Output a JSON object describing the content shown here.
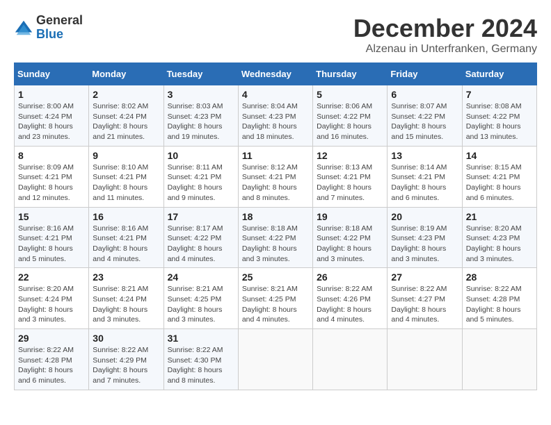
{
  "header": {
    "logo_general": "General",
    "logo_blue": "Blue",
    "month_title": "December 2024",
    "subtitle": "Alzenau in Unterfranken, Germany"
  },
  "days_of_week": [
    "Sunday",
    "Monday",
    "Tuesday",
    "Wednesday",
    "Thursday",
    "Friday",
    "Saturday"
  ],
  "weeks": [
    [
      {
        "day": "1",
        "sunrise": "8:00 AM",
        "sunset": "4:24 PM",
        "daylight": "8 hours and 23 minutes."
      },
      {
        "day": "2",
        "sunrise": "8:02 AM",
        "sunset": "4:24 PM",
        "daylight": "8 hours and 21 minutes."
      },
      {
        "day": "3",
        "sunrise": "8:03 AM",
        "sunset": "4:23 PM",
        "daylight": "8 hours and 19 minutes."
      },
      {
        "day": "4",
        "sunrise": "8:04 AM",
        "sunset": "4:23 PM",
        "daylight": "8 hours and 18 minutes."
      },
      {
        "day": "5",
        "sunrise": "8:06 AM",
        "sunset": "4:22 PM",
        "daylight": "8 hours and 16 minutes."
      },
      {
        "day": "6",
        "sunrise": "8:07 AM",
        "sunset": "4:22 PM",
        "daylight": "8 hours and 15 minutes."
      },
      {
        "day": "7",
        "sunrise": "8:08 AM",
        "sunset": "4:22 PM",
        "daylight": "8 hours and 13 minutes."
      }
    ],
    [
      {
        "day": "8",
        "sunrise": "8:09 AM",
        "sunset": "4:21 PM",
        "daylight": "8 hours and 12 minutes."
      },
      {
        "day": "9",
        "sunrise": "8:10 AM",
        "sunset": "4:21 PM",
        "daylight": "8 hours and 11 minutes."
      },
      {
        "day": "10",
        "sunrise": "8:11 AM",
        "sunset": "4:21 PM",
        "daylight": "8 hours and 9 minutes."
      },
      {
        "day": "11",
        "sunrise": "8:12 AM",
        "sunset": "4:21 PM",
        "daylight": "8 hours and 8 minutes."
      },
      {
        "day": "12",
        "sunrise": "8:13 AM",
        "sunset": "4:21 PM",
        "daylight": "8 hours and 7 minutes."
      },
      {
        "day": "13",
        "sunrise": "8:14 AM",
        "sunset": "4:21 PM",
        "daylight": "8 hours and 6 minutes."
      },
      {
        "day": "14",
        "sunrise": "8:15 AM",
        "sunset": "4:21 PM",
        "daylight": "8 hours and 6 minutes."
      }
    ],
    [
      {
        "day": "15",
        "sunrise": "8:16 AM",
        "sunset": "4:21 PM",
        "daylight": "8 hours and 5 minutes."
      },
      {
        "day": "16",
        "sunrise": "8:16 AM",
        "sunset": "4:21 PM",
        "daylight": "8 hours and 4 minutes."
      },
      {
        "day": "17",
        "sunrise": "8:17 AM",
        "sunset": "4:22 PM",
        "daylight": "8 hours and 4 minutes."
      },
      {
        "day": "18",
        "sunrise": "8:18 AM",
        "sunset": "4:22 PM",
        "daylight": "8 hours and 3 minutes."
      },
      {
        "day": "19",
        "sunrise": "8:18 AM",
        "sunset": "4:22 PM",
        "daylight": "8 hours and 3 minutes."
      },
      {
        "day": "20",
        "sunrise": "8:19 AM",
        "sunset": "4:23 PM",
        "daylight": "8 hours and 3 minutes."
      },
      {
        "day": "21",
        "sunrise": "8:20 AM",
        "sunset": "4:23 PM",
        "daylight": "8 hours and 3 minutes."
      }
    ],
    [
      {
        "day": "22",
        "sunrise": "8:20 AM",
        "sunset": "4:24 PM",
        "daylight": "8 hours and 3 minutes."
      },
      {
        "day": "23",
        "sunrise": "8:21 AM",
        "sunset": "4:24 PM",
        "daylight": "8 hours and 3 minutes."
      },
      {
        "day": "24",
        "sunrise": "8:21 AM",
        "sunset": "4:25 PM",
        "daylight": "8 hours and 3 minutes."
      },
      {
        "day": "25",
        "sunrise": "8:21 AM",
        "sunset": "4:25 PM",
        "daylight": "8 hours and 4 minutes."
      },
      {
        "day": "26",
        "sunrise": "8:22 AM",
        "sunset": "4:26 PM",
        "daylight": "8 hours and 4 minutes."
      },
      {
        "day": "27",
        "sunrise": "8:22 AM",
        "sunset": "4:27 PM",
        "daylight": "8 hours and 4 minutes."
      },
      {
        "day": "28",
        "sunrise": "8:22 AM",
        "sunset": "4:28 PM",
        "daylight": "8 hours and 5 minutes."
      }
    ],
    [
      {
        "day": "29",
        "sunrise": "8:22 AM",
        "sunset": "4:28 PM",
        "daylight": "8 hours and 6 minutes."
      },
      {
        "day": "30",
        "sunrise": "8:22 AM",
        "sunset": "4:29 PM",
        "daylight": "8 hours and 7 minutes."
      },
      {
        "day": "31",
        "sunrise": "8:22 AM",
        "sunset": "4:30 PM",
        "daylight": "8 hours and 8 minutes."
      },
      null,
      null,
      null,
      null
    ]
  ],
  "labels": {
    "sunrise_prefix": "Sunrise: ",
    "sunset_prefix": "Sunset: ",
    "daylight_prefix": "Daylight: "
  }
}
